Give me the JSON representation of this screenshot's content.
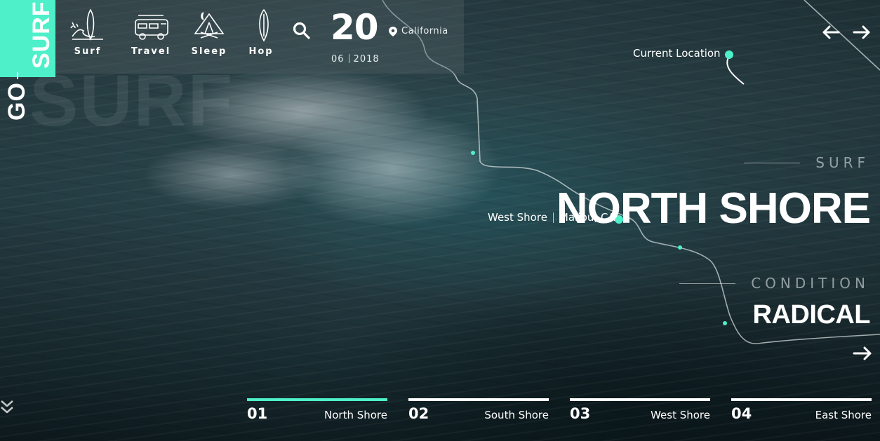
{
  "brand": {
    "go": "GO",
    "surf": "SURF",
    "watermark": "SURF",
    "accent_color": "#4ef0c9"
  },
  "nav": {
    "items": [
      {
        "label": "Surf",
        "icon": "surfboard-splash-icon"
      },
      {
        "label": "Travel",
        "icon": "van-icon"
      },
      {
        "label": "Sleep",
        "icon": "campsite-icon"
      },
      {
        "label": "Hop",
        "icon": "surfboard-icon"
      }
    ],
    "search_icon": "search-icon"
  },
  "date": {
    "day": "20",
    "month": "06",
    "year": "2018"
  },
  "location": {
    "label": "California",
    "icon": "map-pin-icon"
  },
  "map": {
    "current_location": "Current Location"
  },
  "spot": {
    "kicker": "SURF",
    "name": "NORTH SHORE",
    "condition_kicker": "CONDITION",
    "condition": "RADICAL",
    "marker_left": "West Shore",
    "marker_right": "Malibu, CA"
  },
  "tabs": [
    {
      "num": "01",
      "label": "North Shore",
      "active": true
    },
    {
      "num": "02",
      "label": "South Shore",
      "active": false
    },
    {
      "num": "03",
      "label": "West Shore",
      "active": false
    },
    {
      "num": "04",
      "label": "East Shore",
      "active": false
    }
  ]
}
